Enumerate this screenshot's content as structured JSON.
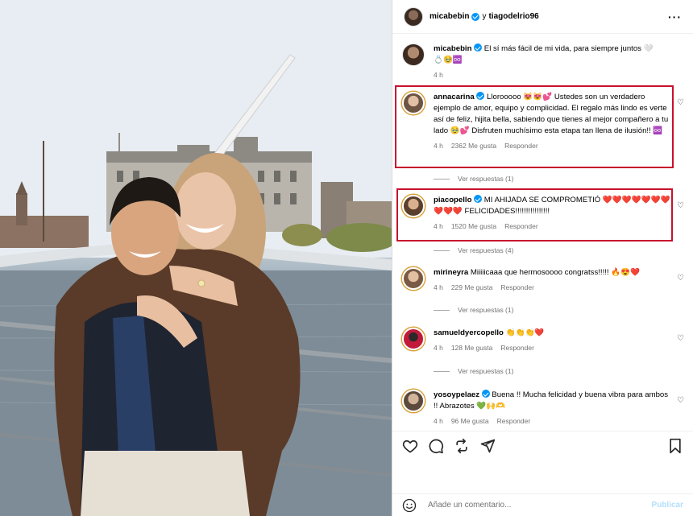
{
  "header": {
    "user1": "micabebin",
    "connector": "y",
    "user2": "tiagodelrio96",
    "more_label": "···"
  },
  "caption": {
    "user": "micabebin",
    "text": "El sí más fácil de mi vida, para siempre juntos 🤍💍🥹♾️",
    "time": "4 h"
  },
  "comments": [
    {
      "user": "annacarina",
      "text": "Llorooooo 😻😻💕 Ustedes son un verdadero ejemplo de amor, equipo y complicidad. El regalo más lindo es verte así de feliz, hijita bella, sabiendo que tienes al mejor compañero a tu lado 🥹💕 Disfruten muchísimo esta etapa tan llena de ilusión!! ♾️",
      "time": "4 h",
      "likes": "2362 Me gusta",
      "reply": "Responder",
      "view_replies": "Ver respuestas (1)"
    },
    {
      "user": "piacopello",
      "text": "MI AHIJADA SE COMPROMETIÓ ❤️❤️❤️❤️❤️❤️❤️❤️❤️❤️ FELICIDADES!!!!!!!!!!!!!!!!",
      "time": "4 h",
      "likes": "1520 Me gusta",
      "reply": "Responder",
      "view_replies": "Ver respuestas (4)"
    },
    {
      "user": "mirineyra",
      "text": "Miiiiicaaa que hermosoooo congratss!!!!! 🔥😍❤️",
      "time": "4 h",
      "likes": "229 Me gusta",
      "reply": "Responder",
      "view_replies": "Ver respuestas (1)"
    },
    {
      "user": "samueldyercopello",
      "text": "👏👏👏❤️",
      "time": "4 h",
      "likes": "128 Me gusta",
      "reply": "Responder",
      "view_replies": "Ver respuestas (1)"
    },
    {
      "user": "yosoypelaez",
      "text": "Buena !! Mucha felicidad y buena vibra para ambos !! Abrazotes 💚🙌🫶",
      "time": "4 h",
      "likes": "96 Me gusta",
      "reply": "Responder"
    }
  ],
  "add_comment": {
    "placeholder": "Añade un comentario...",
    "post_label": "Publicar"
  },
  "icons": {
    "like": "heart-icon",
    "comment": "comment-icon",
    "repost": "repost-icon",
    "share": "share-icon",
    "save": "bookmark-icon",
    "emoji": "emoji-icon",
    "more": "more-icon"
  },
  "colors": {
    "verified": "#0095f6",
    "highlight_box": "#c8102e",
    "publicar": "#b2dffc",
    "muted_text": "#737373"
  }
}
